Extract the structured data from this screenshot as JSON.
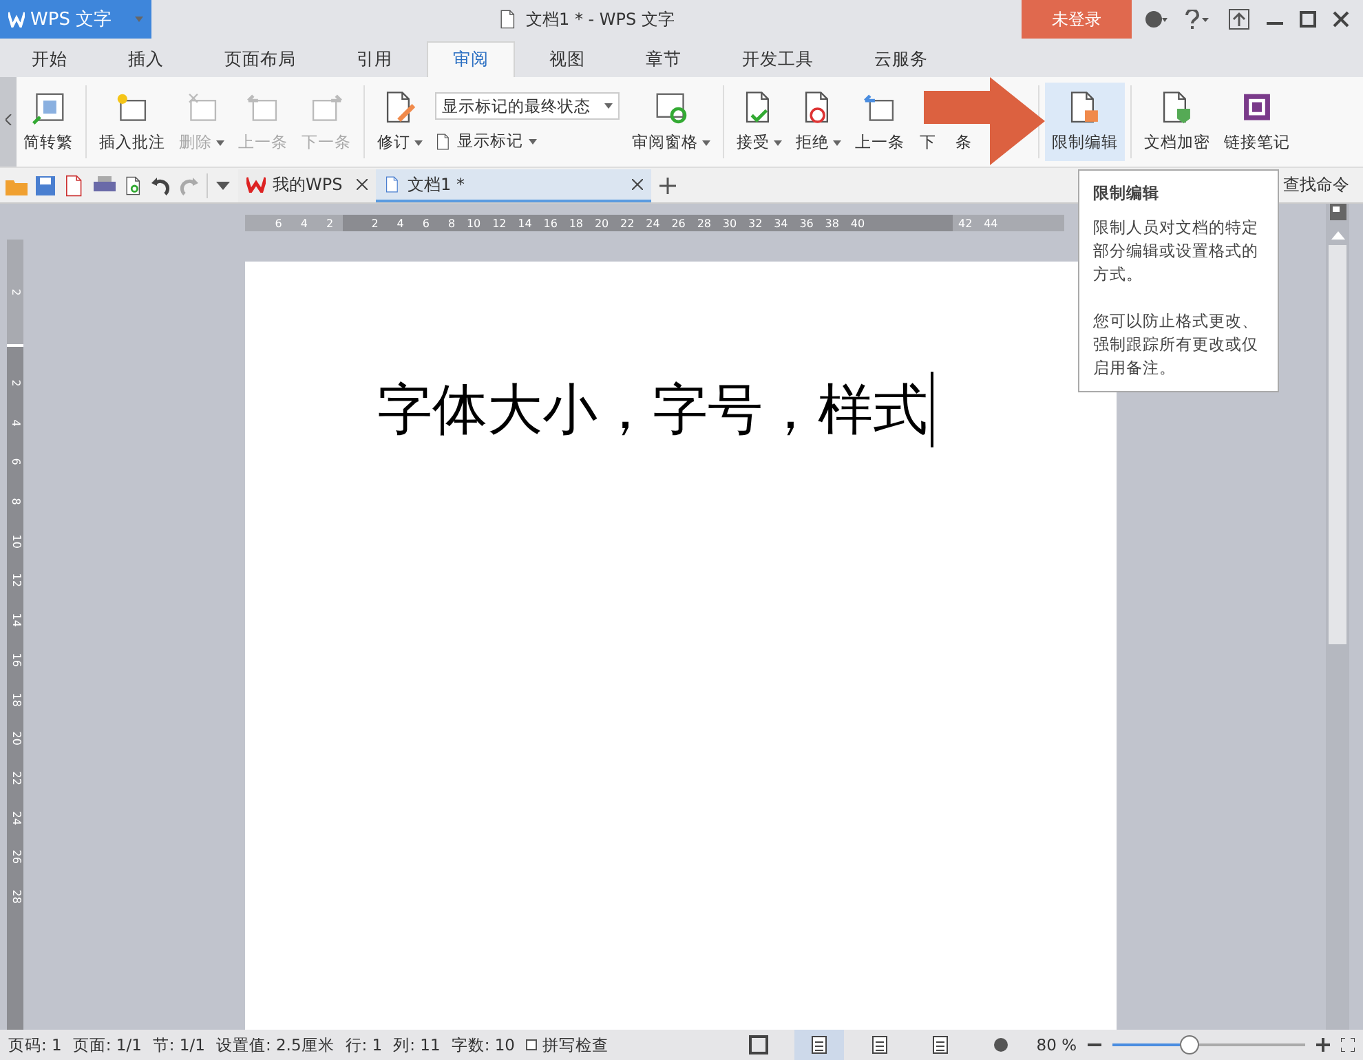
{
  "app_button": {
    "label": "WPS 文字"
  },
  "window": {
    "title": "文档1 * - WPS 文字"
  },
  "login_button": {
    "label": "未登录"
  },
  "tabs": [
    {
      "label": "开始",
      "selected": false
    },
    {
      "label": "插入",
      "selected": false
    },
    {
      "label": "页面布局",
      "selected": false
    },
    {
      "label": "引用",
      "selected": false
    },
    {
      "label": "审阅",
      "selected": true
    },
    {
      "label": "视图",
      "selected": false
    },
    {
      "label": "章节",
      "selected": false
    },
    {
      "label": "开发工具",
      "selected": false
    },
    {
      "label": "云服务",
      "selected": false
    }
  ],
  "ribbon": {
    "convert_button": {
      "label": "简转繁"
    },
    "comment_group": [
      {
        "kind": "insert-comment",
        "label": "插入批注",
        "disabled": false,
        "dropdown": false
      },
      {
        "kind": "delete",
        "label": "删除",
        "disabled": true,
        "dropdown": true
      },
      {
        "kind": "prev",
        "label": "上一条",
        "disabled": true,
        "dropdown": false
      },
      {
        "kind": "next",
        "label": "下一条",
        "disabled": true,
        "dropdown": false
      }
    ],
    "track_button": {
      "label": "修订"
    },
    "markup_select": {
      "value": "显示标记的最终状态"
    },
    "show_markup_button": {
      "label": "显示标记"
    },
    "review_pane_button": {
      "label": "审阅窗格"
    },
    "change_group": [
      {
        "kind": "accept",
        "label": "接受",
        "dropdown": true
      },
      {
        "kind": "reject",
        "label": "拒绝",
        "dropdown": true
      },
      {
        "kind": "prev",
        "label": "上一条",
        "dropdown": false
      }
    ],
    "covered_button": {
      "label_parts": [
        "下",
        "条"
      ]
    },
    "restrict_button": {
      "label": "限制编辑",
      "hovered": true
    },
    "protect_group": [
      {
        "kind": "encrypt",
        "label": "文档加密"
      },
      {
        "kind": "note",
        "label": "链接笔记"
      }
    ]
  },
  "doc_tabs": [
    {
      "kind": "home",
      "label": "我的WPS",
      "selected": false
    },
    {
      "kind": "doc",
      "label": "文档1 *",
      "selected": true
    }
  ],
  "find_command": {
    "label": "查找命令"
  },
  "ruler": {
    "left_numbers": [
      "6",
      "4",
      "2"
    ],
    "right_numbers": [
      "2",
      "4",
      "6",
      "8",
      "10",
      "12",
      "14",
      "16",
      "18",
      "20",
      "22",
      "24",
      "26",
      "28",
      "30",
      "32",
      "34",
      "36",
      "38",
      "40",
      "42",
      "44"
    ]
  },
  "vertical_ruler": {
    "top_numbers": [
      "2"
    ],
    "numbers": [
      "2",
      "4",
      "6",
      "8",
      "10",
      "12",
      "14",
      "16",
      "18",
      "20",
      "22",
      "24",
      "26",
      "28"
    ]
  },
  "document": {
    "text": "字体大小，字号，样式"
  },
  "tooltip": {
    "title": "限制编辑",
    "paragraphs": [
      "限制人员对文档的特定部分编辑或设置格式的方式。",
      "您可以防止格式更改、强制跟踪所有更改或仅启用备注。"
    ]
  },
  "status_bar": {
    "items": [
      "页码: 1",
      "页面: 1/1",
      "节: 1/1",
      "设置值: 2.5厘米",
      "行: 1",
      "列: 11",
      "字数: 10"
    ],
    "spell_check": {
      "label": "拼写检查",
      "checked": false
    },
    "views": [
      {
        "kind": "fullscreen",
        "selected": false
      },
      {
        "kind": "page",
        "selected": true
      },
      {
        "kind": "outline",
        "selected": false
      },
      {
        "kind": "web",
        "selected": false
      },
      {
        "kind": "reading",
        "selected": false
      }
    ],
    "zoom": {
      "reading": "80 %",
      "level": 0.4
    }
  }
}
